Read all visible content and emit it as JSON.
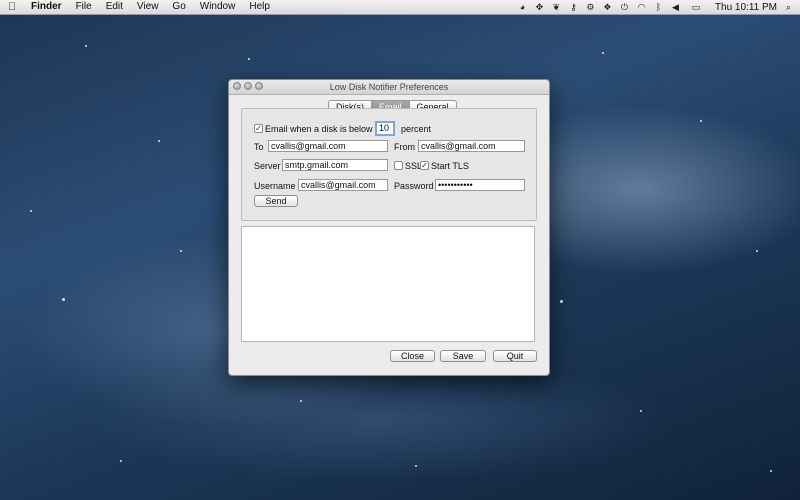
{
  "menubar": {
    "apple_icon": "apple-icon",
    "app_name": "Finder",
    "items": [
      "File",
      "Edit",
      "View",
      "Go",
      "Window",
      "Help"
    ],
    "status_icons": [
      "colorsync-icon",
      "dropbox-icon",
      "evernote-icon",
      "key-icon",
      "gear-icon",
      "dropbox-alt-icon",
      "power-icon",
      "wifi-icon",
      "bluetooth-icon",
      "volume-icon",
      "battery-icon"
    ],
    "clock": "Thu 10:11 PM",
    "search_icon": "spotlight-search-icon"
  },
  "window": {
    "title": "Low Disk Notifier Preferences",
    "tabs": [
      {
        "label": "Disk(s)",
        "selected": false
      },
      {
        "label": "Email",
        "selected": true
      },
      {
        "label": "General",
        "selected": false
      }
    ],
    "email_panel": {
      "email_checkbox": {
        "label": "Email when a disk is below",
        "checked": true
      },
      "threshold_value": "10",
      "threshold_unit": "percent",
      "to_label": "To",
      "to_value": "cvallis@gmail.com",
      "from_label": "From",
      "from_value": "cvallis@gmail.com",
      "server_label": "Server",
      "server_value": "smtp.gmail.com",
      "ssl": {
        "label": "SSL",
        "checked": false
      },
      "start_tls": {
        "label": "Start TLS",
        "checked": true
      },
      "username_label": "Username",
      "username_value": "cvallis@gmail.com",
      "password_label": "Password",
      "password_value": "•••••••••••",
      "send_label": "Send"
    },
    "buttons": {
      "close": "Close",
      "save": "Save",
      "quit": "Quit"
    }
  }
}
